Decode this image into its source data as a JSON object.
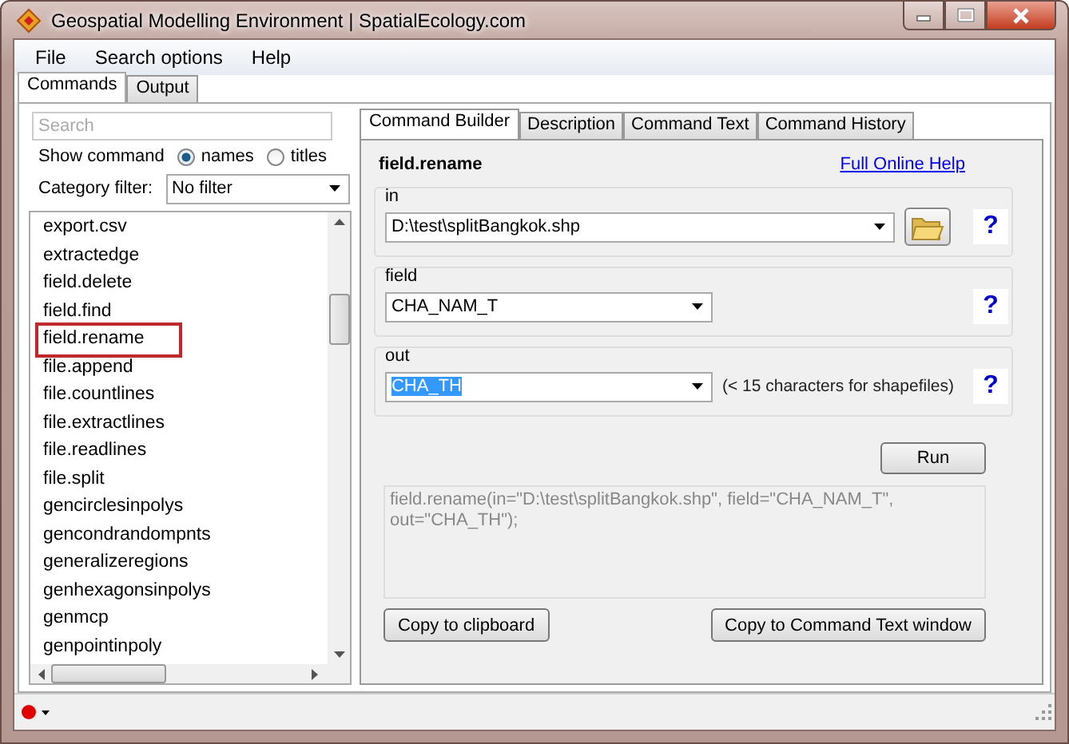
{
  "window": {
    "title": "Geospatial Modelling Environment | SpatialEcology.com"
  },
  "menu": [
    "File",
    "Search options",
    "Help"
  ],
  "main_tabs": [
    {
      "label": "Commands",
      "selected": true
    },
    {
      "label": "Output",
      "selected": false
    }
  ],
  "search": {
    "placeholder": "Search"
  },
  "show_command": {
    "label": "Show command",
    "options": [
      {
        "label": "names",
        "selected": true
      },
      {
        "label": "titles",
        "selected": false
      }
    ]
  },
  "category_filter": {
    "label": "Category filter:",
    "value": "No filter"
  },
  "commands": [
    {
      "name": "export.csv",
      "highlighted": false
    },
    {
      "name": "extractedge",
      "highlighted": false
    },
    {
      "name": "field.delete",
      "highlighted": false
    },
    {
      "name": "field.find",
      "highlighted": false
    },
    {
      "name": "field.rename",
      "highlighted": true
    },
    {
      "name": "file.append",
      "highlighted": false
    },
    {
      "name": "file.countlines",
      "highlighted": false
    },
    {
      "name": "file.extractlines",
      "highlighted": false
    },
    {
      "name": "file.readlines",
      "highlighted": false
    },
    {
      "name": "file.split",
      "highlighted": false
    },
    {
      "name": "gencirclesinpolys",
      "highlighted": false
    },
    {
      "name": "gencondrandompnts",
      "highlighted": false
    },
    {
      "name": "generalizeregions",
      "highlighted": false
    },
    {
      "name": "genhexagonsinpolys",
      "highlighted": false
    },
    {
      "name": "genmcp",
      "highlighted": false
    },
    {
      "name": "genpointinpoly",
      "highlighted": false
    }
  ],
  "builder_tabs": [
    {
      "label": "Command Builder",
      "selected": true
    },
    {
      "label": "Description",
      "selected": false
    },
    {
      "label": "Command Text",
      "selected": false
    },
    {
      "label": "Command History",
      "selected": false
    }
  ],
  "command": {
    "title": "field.rename",
    "help_link": "Full Online Help"
  },
  "parameters": [
    {
      "label": "in",
      "kind": "file",
      "value": "D:\\test\\splitBangkok.shp",
      "text_selected": false,
      "help": "?"
    },
    {
      "label": "field",
      "kind": "field",
      "value": "CHA_NAM_T",
      "text_selected": false,
      "help": "?"
    },
    {
      "label": "out",
      "kind": "field",
      "value": "CHA_TH",
      "text_selected": true,
      "note": "(< 15 characters for shapefiles)",
      "help": "?"
    }
  ],
  "run_button": "Run",
  "command_text": "field.rename(in=\"D:\\test\\splitBangkok.shp\", field=\"CHA_NAM_T\", out=\"CHA_TH\");",
  "buttons": [
    "Copy to clipboard",
    "Copy to Command Text window"
  ]
}
